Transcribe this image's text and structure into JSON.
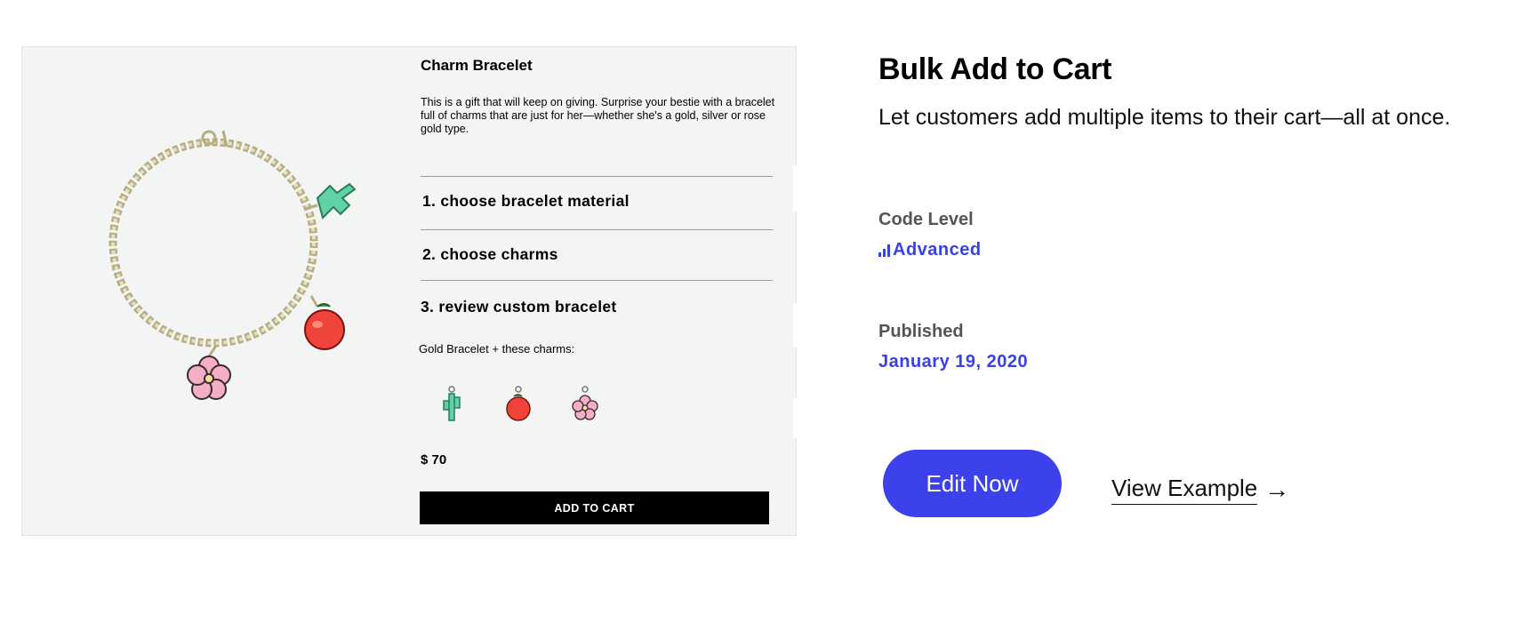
{
  "preview": {
    "product_title": "Charm Bracelet",
    "description": "This is a gift that will keep on giving. Surprise your bestie with a bracelet full of charms that are just for her—whether she's a gold, silver or rose gold type.",
    "steps": [
      "1. choose bracelet material",
      "2. choose charms",
      "3. review custom bracelet"
    ],
    "combo_text": "Gold Bracelet + these charms:",
    "charms": [
      "cactus-charm",
      "apple-charm",
      "flower-charm"
    ],
    "price": "$ 70",
    "add_to_cart": "ADD TO CART",
    "colors": {
      "card_bg": "#f3f5f5",
      "cactus": "#5fd3a6",
      "apple": "#f0443a",
      "flower": "#f4aec6",
      "chain": "#c9bf94"
    }
  },
  "info": {
    "title": "Bulk Add to Cart",
    "subtitle": "Let customers add multiple items to their cart—all at once.",
    "code_level_label": "Code Level",
    "code_level_value": "Advanced",
    "published_label": "Published",
    "published_value": "January 19, 2020",
    "edit_button": "Edit Now",
    "view_link": "View Example",
    "view_arrow": "→",
    "colors": {
      "accent": "#3841e8",
      "button": "#3c41ec"
    }
  }
}
